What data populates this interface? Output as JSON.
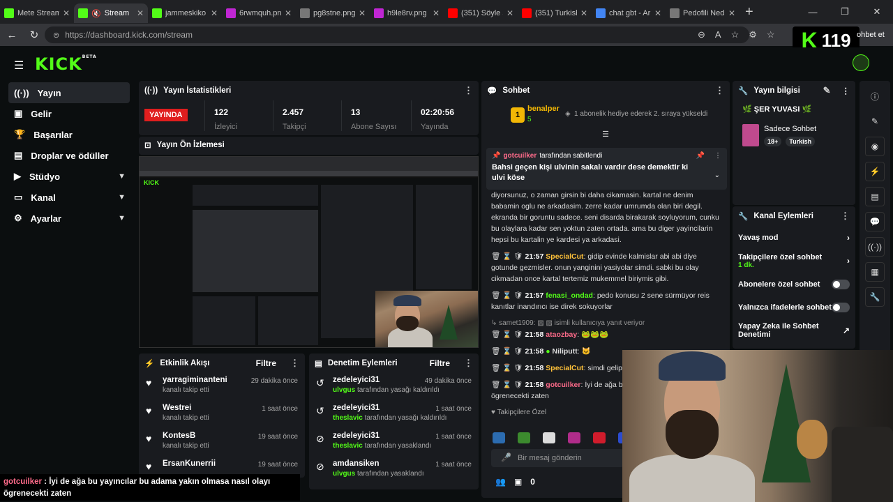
{
  "browser": {
    "tabs": [
      {
        "label": "Mete Stream",
        "color": "#53fc18"
      },
      {
        "label": "Stream",
        "color": "#53fc18",
        "active": true
      },
      {
        "label": "jammeskiko",
        "color": "#53fc18"
      },
      {
        "label": "6rwmquh.png",
        "color": "#c026d3"
      },
      {
        "label": "pg8stne.png",
        "color": "#888888"
      },
      {
        "label": "h9le8rv.png",
        "color": "#c026d3"
      },
      {
        "label": "(351) Söyle S",
        "color": "#ff0000"
      },
      {
        "label": "(351) Turkish",
        "color": "#ff0000"
      },
      {
        "label": "chat gbt - Ar",
        "color": "#4285f4"
      },
      {
        "label": "Pedofili Nedir",
        "color": "#888888"
      }
    ],
    "url": "https://dashboard.kick.com/stream",
    "sohbet_et": "ohbet et"
  },
  "badge": {
    "k": "K",
    "num": "119"
  },
  "logo": "KICK",
  "logo_beta": "BETA",
  "sidebar": {
    "items": [
      {
        "label": "Yayın",
        "icon": "broadcast-icon"
      },
      {
        "label": "Gelir",
        "icon": "money-icon"
      },
      {
        "label": "Başarılar",
        "icon": "trophy-icon"
      },
      {
        "label": "Droplar ve ödüller",
        "icon": "gift-icon"
      },
      {
        "label": "Stüdyo",
        "icon": "video-icon",
        "chev": "⌄"
      },
      {
        "label": "Kanal",
        "icon": "monitor-icon",
        "chev": "⌄"
      },
      {
        "label": "Ayarlar",
        "icon": "gear-icon",
        "chev": "⌄"
      }
    ]
  },
  "stats": {
    "title": "Yayın İstatistikleri",
    "live": "YAYINDA",
    "items": [
      {
        "value": "122",
        "label": "İzleyici"
      },
      {
        "value": "2.457",
        "label": "Takipçi"
      },
      {
        "value": "13",
        "label": "Abone Sayısı"
      },
      {
        "value": "02:20:56",
        "label": "Yayında"
      }
    ]
  },
  "preview": {
    "title": "Yayın Ön İzlemesi"
  },
  "activity": {
    "title": "Etkinlik Akışı",
    "filter": "Filtre",
    "rows": [
      {
        "name": "yarragiminanteni",
        "sub": "kanalı takip etti",
        "time": "29 dakika önce"
      },
      {
        "name": "Westrei",
        "sub": "kanalı takip etti",
        "time": "1 saat önce"
      },
      {
        "name": "KontesB",
        "sub": "kanalı takip etti",
        "time": "19 saat önce"
      },
      {
        "name": "ErsanKunerrii",
        "sub": "",
        "time": "19 saat önce"
      }
    ]
  },
  "moderation": {
    "title": "Denetim Eylemleri",
    "filter": "Filtre",
    "rows": [
      {
        "name": "zedeleyici31",
        "by": "ulvgus",
        "sub": "tarafından yasağı kaldırıldı",
        "time": "49 dakika önce"
      },
      {
        "name": "zedeleyici31",
        "by": "theslavic",
        "sub": "tarafından yasağı kaldırıldı",
        "time": "1 saat önce"
      },
      {
        "name": "zedeleyici31",
        "by": "theslavic",
        "sub": "tarafından yasaklandı",
        "time": "1 saat önce"
      },
      {
        "name": "amdansiken",
        "by": "ulvgus",
        "sub": "tarafından yasaklandı",
        "time": "1 saat önce"
      }
    ]
  },
  "chat": {
    "title": "Sohbet",
    "top_user": "benalper",
    "top_rank": "1",
    "top_count": "5",
    "top_msg": "1 abonelik hediye ederek 2. sıraya yükseldi",
    "pinned_by": "gotcuilker",
    "pinned_suffix": "tarafından sabitlendi",
    "pinned_text": "Bahsi geçen kişi ulvinin sakalı vardır dese demektir ki ulvi köse",
    "block": "diyorsunuz, o zaman girsin bi daha cikamasin. kartal ne denim babamin oglu ne arkadasim. zerre kadar umrumda olan biri degil. ekranda bir goruntu sadece. seni disarda birakarak soyluyorum, cunku bu olaylara kadar sen yoktun zaten ortada. ama bu diger yayincilarin hepsi bu kartalin ye kardesi ya arkadasi.",
    "messages": [
      {
        "time": "21:57",
        "user": "SpecialCut",
        "color": "yel",
        "text": "gidip evinde kalmislar abi abi diye gotunde gezmisler. onun yanginini yasiyolar simdi. sabki bu olay cikmadan once kartal tertemiz mukemmel biriymis gibi."
      },
      {
        "time": "21:57",
        "user": "fenasi_ondad",
        "color": "grn",
        "text": "pedo konusu 2 sene sürmüyor reis kanıtlar inandırıcı ise direk sokuyorlar"
      }
    ],
    "reply_user": "samet1909",
    "reply_text": "isimli kullanıcıya yanıt veriyor",
    "messages2": [
      {
        "time": "21:58",
        "user": "ataozbay",
        "color": "red",
        "text": ""
      },
      {
        "time": "21:58",
        "user": "Niliputt",
        "color": "grn",
        "text": ""
      },
      {
        "time": "21:58",
        "user": "SpecialCut",
        "color": "yel",
        "text": "simdi gelip calisiyolar"
      },
      {
        "time": "21:58",
        "user": "gotcuilker",
        "color": "red",
        "text": "İyi de ağa bu olmasa nasıl olayı ögrenecekti zaten"
      }
    ],
    "follower_only": "Takipçilere Özel",
    "placeholder": "Bir mesaj gönderin",
    "count": "0"
  },
  "streaminfo": {
    "title": "Yayın bilgisi",
    "name": "ŞER YUVASI",
    "category": "Sadece Sohbet",
    "tags": [
      "18+",
      "Turkish"
    ]
  },
  "channel_actions": {
    "title": "Kanal Eylemleri",
    "items": [
      {
        "label": "Yavaş mod",
        "kind": "chev"
      },
      {
        "label": "Takipçilere özel sohbet",
        "sub": "1 dk.",
        "kind": "chev"
      },
      {
        "label": "Abonelere özel sohbet",
        "kind": "toggle"
      },
      {
        "label": "Yalnızca ifadelerle sohbet",
        "kind": "toggle"
      },
      {
        "label": "Yapay Zeka ile Sohbet Denetimi",
        "kind": "ext"
      }
    ]
  },
  "caption": {
    "user": "gotcuilker",
    "text": "İyi de ağa bu yayıncılar bu adama yakın olmasa nasıl olayı ögrenecekti zaten"
  }
}
